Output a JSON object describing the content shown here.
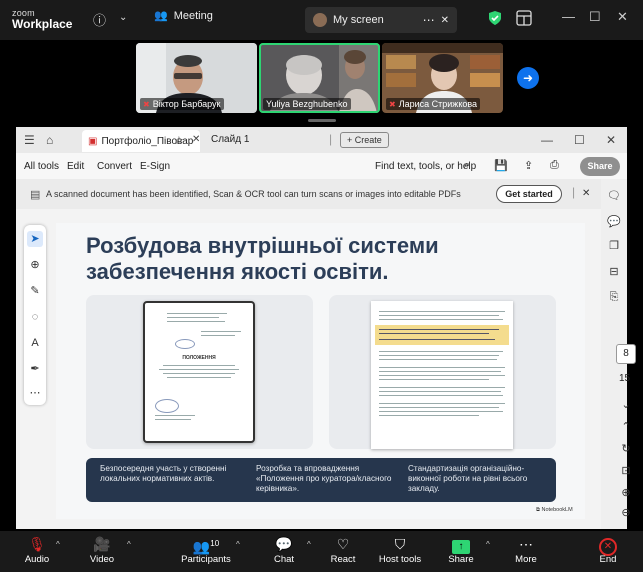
{
  "topbar": {
    "logo_top": "zoom",
    "logo_bottom": "Workplace",
    "meeting_label": "Meeting",
    "screen_label": "My screen"
  },
  "participants": [
    {
      "name": "Віктор Барбарук"
    },
    {
      "name": "Yuliya Bezghubenko"
    },
    {
      "name": "Лариса Стрижкова"
    }
  ],
  "acrobat": {
    "doc_tab": "Портфоліо_Півоварова...",
    "slide_tab": "Слайд 1",
    "create": "Create",
    "menu": [
      "All tools",
      "Edit",
      "Convert",
      "E-Sign"
    ],
    "find": "Find text, tools, or help",
    "share": "Share",
    "notice": "A scanned document has been identified, Scan & OCR tool can turn scans or images into editable PDFs",
    "get_started": "Get started",
    "page_current": "8",
    "page_total": "15"
  },
  "slide": {
    "title": "Розбудова внутрішньої системи забезпечення якості освіти.",
    "band": [
      "Безпосередня участь у створенні локальних нормативних актів.",
      "Розробка та впровадження «Положення про куратора/класного керівника».",
      "Стандартизація організаційно-виконної роботи на рівні всього закладу."
    ],
    "notebook": "NotebookLM",
    "paper_title": "ПОЛОЖЕННЯ"
  },
  "bottombar": {
    "audio": "Audio",
    "video": "Video",
    "participants": "Participants",
    "participants_count": "10",
    "chat": "Chat",
    "react": "React",
    "host_tools": "Host tools",
    "share": "Share",
    "more": "More",
    "end": "End"
  }
}
